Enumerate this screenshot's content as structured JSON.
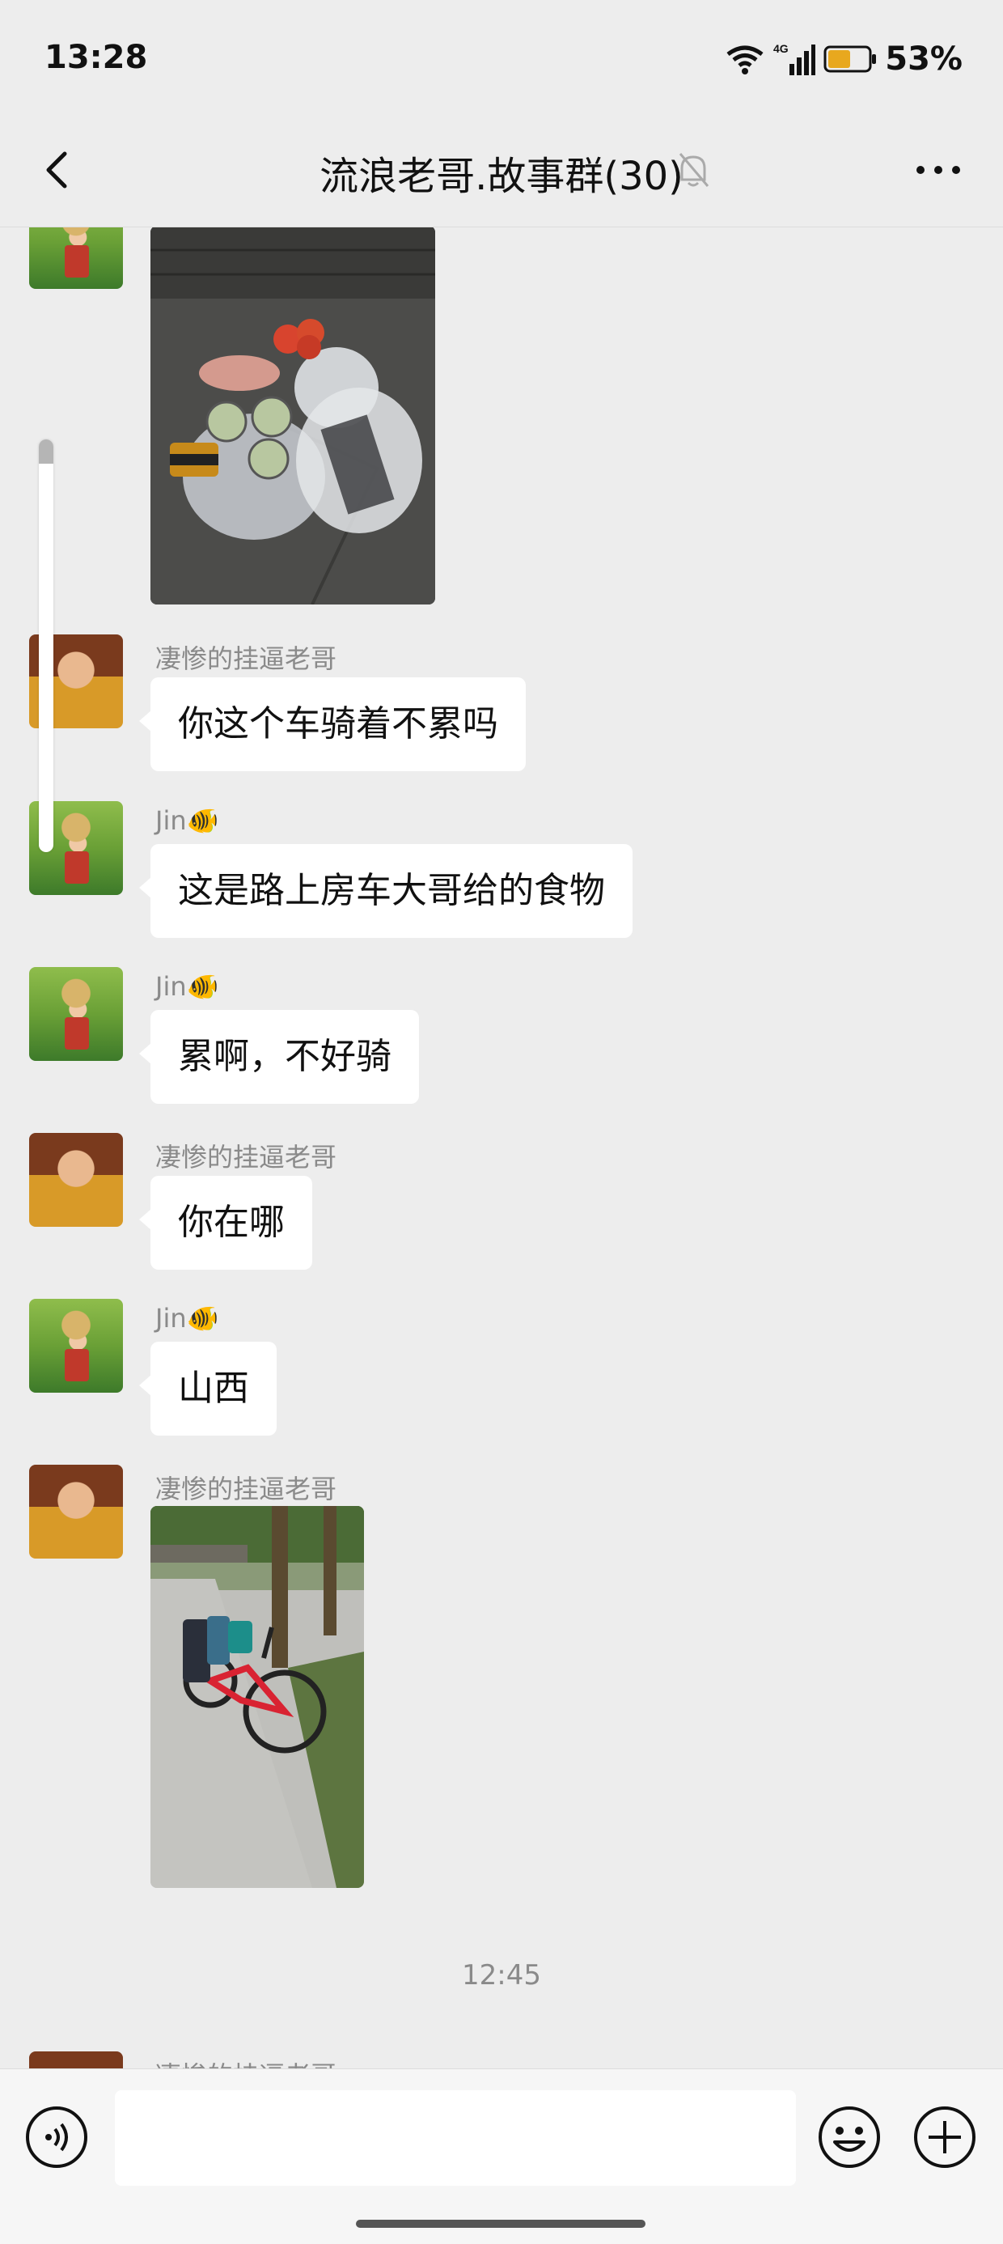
{
  "status_bar": {
    "time": "13:28",
    "network_label": "4G",
    "battery_level": "53%"
  },
  "header": {
    "title": "流浪老哥.故事群(30)"
  },
  "messages": [
    {
      "sender": "凄惨的挂逼老哥",
      "text": "你这个车骑着不累吗"
    },
    {
      "sender": "Jin🐠",
      "text": "这是路上房车大哥给的食物"
    },
    {
      "sender": "Jin🐠",
      "text": "累啊，不好骑"
    },
    {
      "sender": "凄惨的挂逼老哥",
      "text": "你在哪"
    },
    {
      "sender": "Jin🐠",
      "text": "山西"
    },
    {
      "sender": "凄惨的挂逼老哥"
    }
  ],
  "timestamp": "12:45",
  "partial_sender": "凄惨的挂逼老哥",
  "input": {
    "value": "",
    "placeholder": ""
  }
}
